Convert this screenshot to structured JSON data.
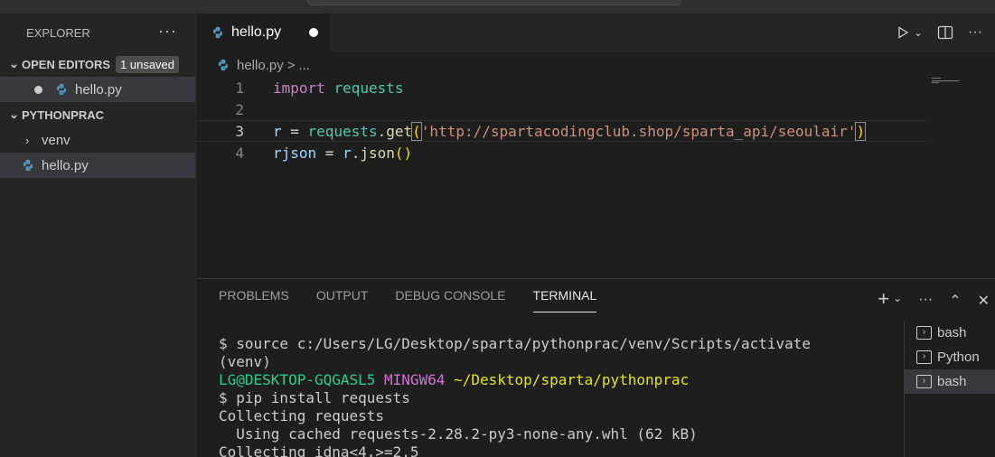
{
  "sidebar": {
    "title": "EXPLORER",
    "more": "···",
    "open_editors": {
      "label": "OPEN EDITORS",
      "badge": "1 unsaved",
      "items": [
        {
          "label": "hello.py"
        }
      ]
    },
    "folder": {
      "label": "PYTHONPRAC",
      "items": [
        {
          "label": "venv"
        },
        {
          "label": "hello.py"
        }
      ]
    }
  },
  "tab": {
    "label": "hello.py"
  },
  "breadcrumb": {
    "file": "hello.py",
    "sep": ">",
    "more": "..."
  },
  "editor": {
    "lines": [
      {
        "num": "1",
        "tokens": {
          "kw": "import",
          "mod": "requests"
        }
      },
      {
        "num": "2"
      },
      {
        "num": "3",
        "tokens": {
          "var": "r",
          "eq": " = ",
          "mod": "requests",
          "dot": ".",
          "fn": "get",
          "open": "(",
          "str": "'http://spartacodingclub.shop/sparta_api/seoulair'",
          "close": ")"
        }
      },
      {
        "num": "4",
        "tokens": {
          "var": "rjson",
          "eq": " = ",
          "var2": "r",
          "dot": ".",
          "fn": "json",
          "parens": "()"
        }
      }
    ]
  },
  "panel": {
    "tabs": [
      "PROBLEMS",
      "OUTPUT",
      "DEBUG CONSOLE",
      "TERMINAL"
    ],
    "terminal": {
      "line1": "$ source c:/Users/LG/Desktop/sparta/pythonprac/venv/Scripts/activate",
      "line2": "(venv)",
      "prompt_user": "LG@DESKTOP-GQGASL5",
      "prompt_shell": "MINGW64",
      "prompt_path": "~/Desktop/sparta/pythonprac",
      "line4": "$ pip install requests",
      "line5": "Collecting requests",
      "line6": "  Using cached requests-2.28.2-py3-none-any.whl (62 kB)",
      "line7": "Collecting idna<4,>=2.5"
    },
    "terminals": [
      {
        "label": "bash"
      },
      {
        "label": "Python"
      },
      {
        "label": "bash"
      }
    ]
  },
  "icons": {
    "python": "python-file-icon",
    "run": "play-icon",
    "split": "split-editor-icon",
    "add": "plus-icon",
    "terminal": "terminal-icon"
  },
  "colors": {
    "accent_py": "#519aba",
    "keyword": "#c586c0",
    "module": "#4ec9b0",
    "string": "#ce9178",
    "function": "#dcdcaa"
  }
}
